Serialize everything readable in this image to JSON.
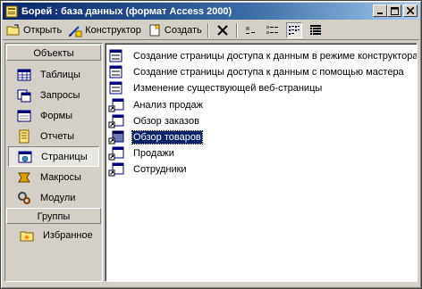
{
  "window": {
    "title": "Борей : база данных (формат Access 2000)",
    "buttons": {
      "minimize": "_",
      "maximize": "□",
      "close": "×"
    }
  },
  "toolbar": {
    "open_label": "Открыть",
    "design_label": "Конструктор",
    "create_label": "Создать"
  },
  "nav": {
    "objects_header": "Объекты",
    "items": [
      {
        "label": "Таблицы",
        "icon": "table-icon"
      },
      {
        "label": "Запросы",
        "icon": "query-icon"
      },
      {
        "label": "Формы",
        "icon": "form-icon"
      },
      {
        "label": "Отчеты",
        "icon": "report-icon"
      },
      {
        "label": "Страницы",
        "icon": "page-icon",
        "selected": true
      },
      {
        "label": "Макросы",
        "icon": "macro-icon"
      },
      {
        "label": "Модули",
        "icon": "module-icon"
      }
    ],
    "groups_header": "Группы",
    "favorites_label": "Избранное"
  },
  "list": {
    "items": [
      {
        "label": "Создание страницы доступа к данным в режиме конструктора",
        "icon": "wizard-icon"
      },
      {
        "label": "Создание страницы доступа к данным с помощью мастера",
        "icon": "wizard-icon"
      },
      {
        "label": "Изменение существующей веб-страницы",
        "icon": "wizard-icon"
      },
      {
        "label": "Анализ продаж",
        "icon": "page-shortcut-icon"
      },
      {
        "label": "Обзор заказов",
        "icon": "page-shortcut-icon"
      },
      {
        "label": "Обзор товаров",
        "icon": "page-shortcut-icon",
        "selected": true
      },
      {
        "label": "Продажи",
        "icon": "page-shortcut-icon"
      },
      {
        "label": "Сотрудники",
        "icon": "page-shortcut-icon"
      }
    ]
  },
  "colors": {
    "titlebar_start": "#0a246a",
    "titlebar_end": "#a6caf0",
    "face": "#d4d0c8",
    "selection": "#0a246a"
  }
}
